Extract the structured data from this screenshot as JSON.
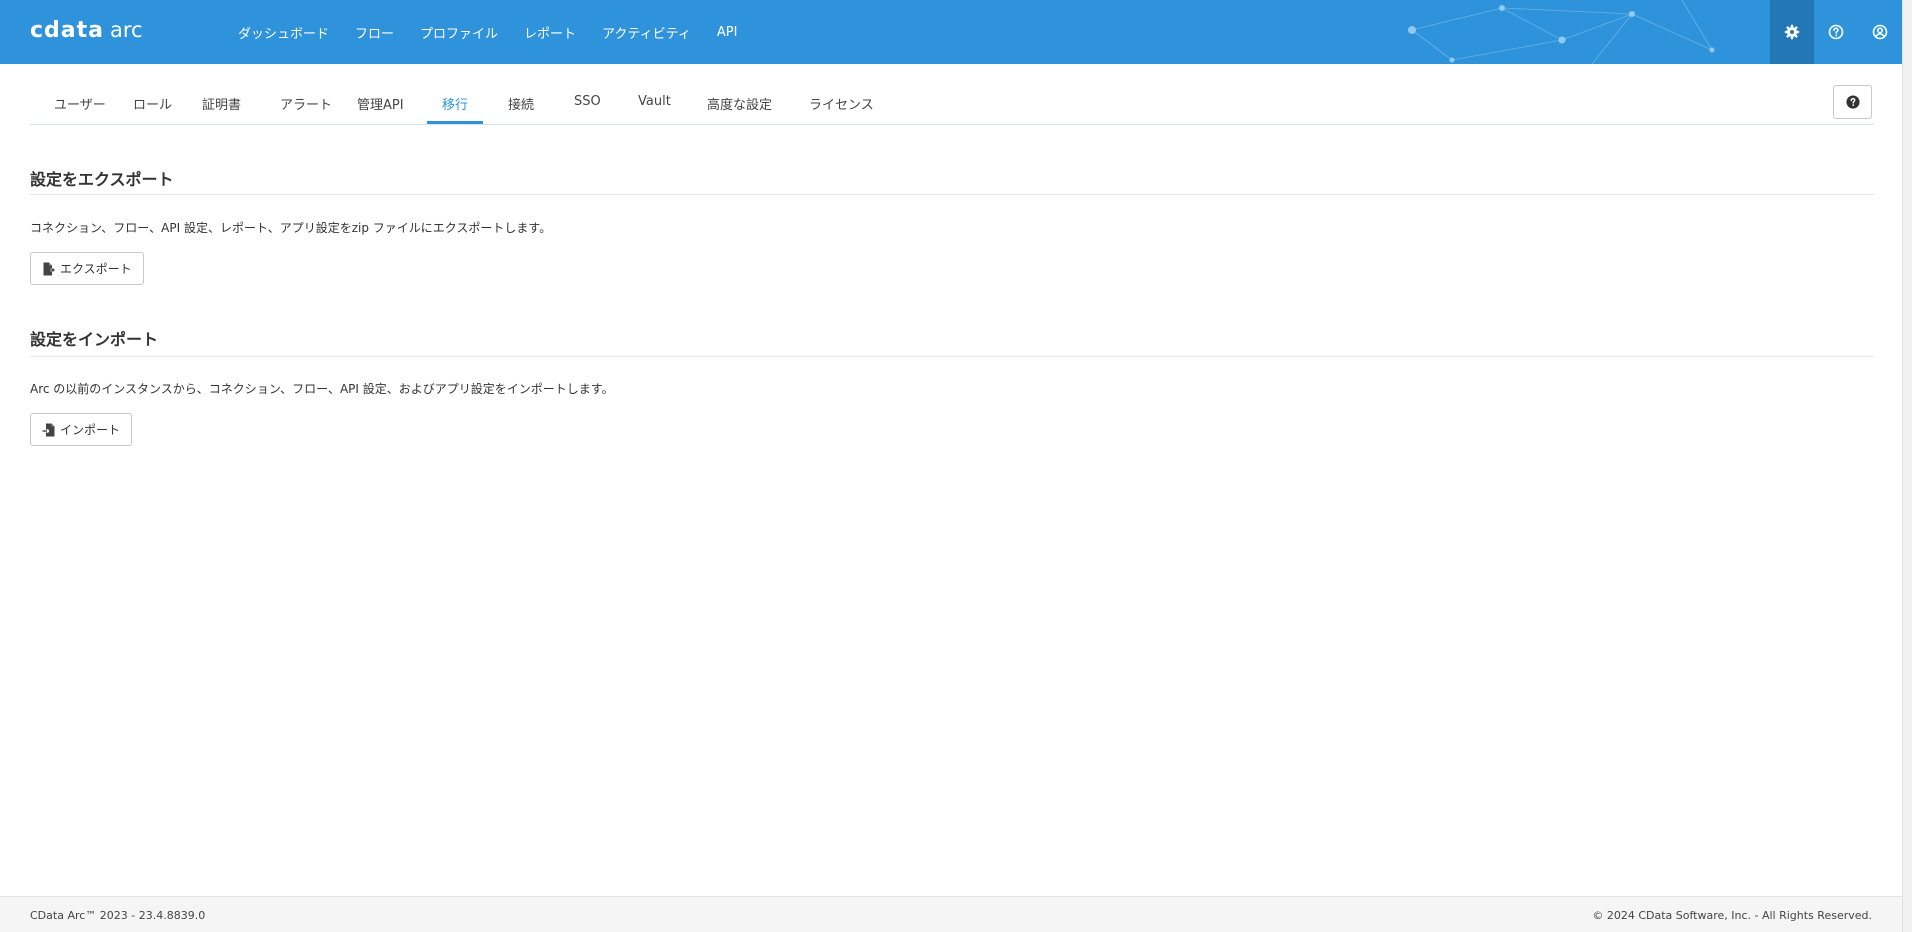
{
  "header": {
    "logo_brand": "cdata",
    "logo_product": "arc",
    "nav": [
      "ダッシュボード",
      "フロー",
      "プロファイル",
      "レポート",
      "アクティビティ",
      "API"
    ],
    "icons": [
      "gear-icon",
      "question-circle-icon",
      "user-circle-icon"
    ],
    "accent_color": "#2f93dc"
  },
  "tabs": {
    "items": [
      "ユーザー",
      "ロール",
      "証明書",
      "アラート",
      "管理API",
      "移行",
      "接続",
      "SSO",
      "Vault",
      "高度な設定",
      "ライセンス"
    ],
    "active": "移行",
    "help_icon": "question-circle-icon"
  },
  "export": {
    "title": "設定をエクスポート",
    "description": "コネクション、フロー、API 設定、レポート、アプリ設定をzip ファイルにエクスポートします。",
    "button_label": "エクスポート",
    "button_icon": "file-export-icon"
  },
  "import": {
    "title": "設定をインポート",
    "description": "Arc の以前のインスタンスから、コネクション、フロー、API 設定、およびアプリ設定をインポートします。",
    "button_label": "インポート",
    "button_icon": "file-import-icon"
  },
  "footer": {
    "version": "CData Arc™ 2023 - 23.4.8839.0",
    "copyright": "© 2024 CData Software, Inc. - All Rights Reserved."
  }
}
